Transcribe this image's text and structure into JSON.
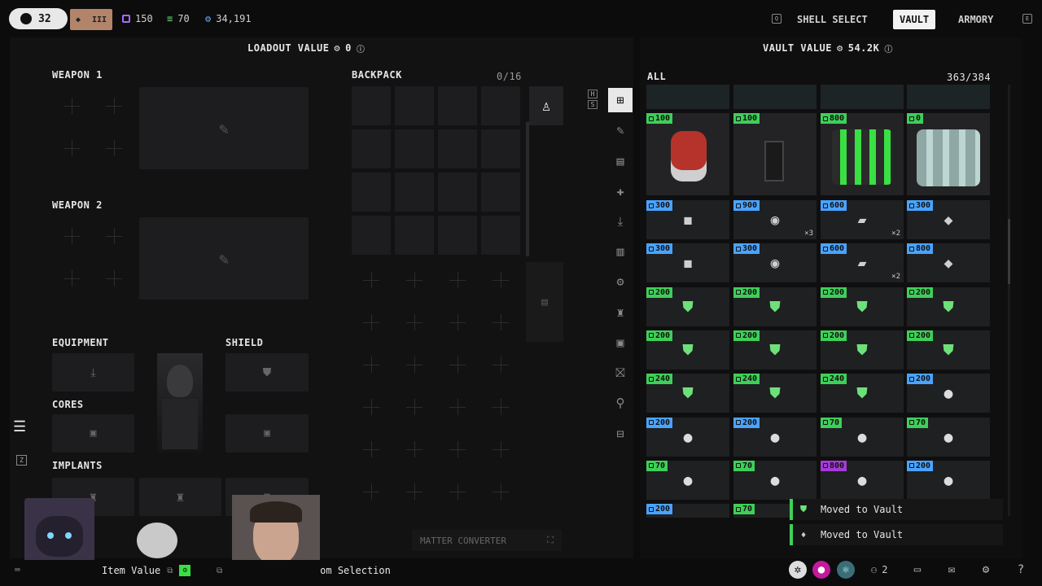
{
  "topbar": {
    "level": "32",
    "rank_badge": "III",
    "currencies": [
      {
        "name": "credits-purple",
        "value": "150",
        "color": "#a56bff"
      },
      {
        "name": "credits-green",
        "value": "70",
        "color": "#6ee07a"
      },
      {
        "name": "credits-blue",
        "value": "34,191",
        "color": "#6aa8ff"
      }
    ],
    "nav": {
      "shell_select": "SHELL SELECT",
      "vault": "VAULT",
      "armory": "ARMORY"
    }
  },
  "loadout": {
    "title": "LOADOUT VALUE",
    "value": "0",
    "weapon1": "WEAPON 1",
    "weapon2": "WEAPON 2",
    "equipment": "EQUIPMENT",
    "shield": "SHIELD",
    "cores": "CORES",
    "implants": "IMPLANTS",
    "backpack": "BACKPACK",
    "backpack_count": "0/16",
    "matter_converter": "MATTER CONVERTER",
    "hint_keys": [
      "H",
      "S"
    ]
  },
  "vault": {
    "title": "VAULT VALUE",
    "value": "54.2K",
    "filter": "ALL",
    "count": "363/384",
    "rows": [
      [
        {
          "p": "100",
          "c": "#3ecf59",
          "qty": ""
        },
        {
          "p": "100",
          "c": "#3ecf59",
          "qty": ""
        },
        {
          "p": "800",
          "c": "#3ecf59",
          "qty": ""
        },
        {
          "p": "0",
          "c": "#3ecf59",
          "qty": ""
        }
      ],
      [
        {
          "p": "300",
          "c": "#4aa3ff",
          "qty": ""
        },
        {
          "p": "900",
          "c": "#4aa3ff",
          "qty": "×3"
        },
        {
          "p": "600",
          "c": "#4aa3ff",
          "qty": "×2"
        },
        {
          "p": "300",
          "c": "#4aa3ff",
          "qty": ""
        }
      ],
      [
        {
          "p": "300",
          "c": "#4aa3ff",
          "qty": ""
        },
        {
          "p": "300",
          "c": "#4aa3ff",
          "qty": ""
        },
        {
          "p": "600",
          "c": "#4aa3ff",
          "qty": "×2"
        },
        {
          "p": "800",
          "c": "#4aa3ff",
          "qty": ""
        }
      ],
      [
        {
          "p": "200",
          "c": "#3ecf59",
          "qty": ""
        },
        {
          "p": "200",
          "c": "#3ecf59",
          "qty": ""
        },
        {
          "p": "200",
          "c": "#3ecf59",
          "qty": ""
        },
        {
          "p": "200",
          "c": "#3ecf59",
          "qty": ""
        }
      ],
      [
        {
          "p": "200",
          "c": "#3ecf59",
          "qty": ""
        },
        {
          "p": "200",
          "c": "#3ecf59",
          "qty": ""
        },
        {
          "p": "200",
          "c": "#3ecf59",
          "qty": ""
        },
        {
          "p": "200",
          "c": "#3ecf59",
          "qty": ""
        }
      ],
      [
        {
          "p": "240",
          "c": "#3ecf59",
          "qty": ""
        },
        {
          "p": "240",
          "c": "#3ecf59",
          "qty": ""
        },
        {
          "p": "240",
          "c": "#3ecf59",
          "qty": ""
        },
        {
          "p": "200",
          "c": "#4aa3ff",
          "qty": ""
        }
      ],
      [
        {
          "p": "200",
          "c": "#4aa3ff",
          "qty": ""
        },
        {
          "p": "200",
          "c": "#4aa3ff",
          "qty": ""
        },
        {
          "p": "70",
          "c": "#3ecf59",
          "qty": ""
        },
        {
          "p": "70",
          "c": "#3ecf59",
          "qty": ""
        }
      ],
      [
        {
          "p": "70",
          "c": "#3ecf59",
          "qty": ""
        },
        {
          "p": "70",
          "c": "#3ecf59",
          "qty": ""
        },
        {
          "p": "800",
          "c": "#a43bd6",
          "qty": ""
        },
        {
          "p": "200",
          "c": "#4aa3ff",
          "qty": ""
        }
      ],
      [
        {
          "p": "200",
          "c": "#4aa3ff",
          "qty": ""
        },
        {
          "p": "70",
          "c": "#3ecf59",
          "qty": ""
        }
      ]
    ]
  },
  "toasts": [
    "Moved to Vault",
    "Moved to Vault"
  ],
  "bottombar": {
    "item_value": "Item Value",
    "custom_selection": "om Selection",
    "squad_count": "2"
  }
}
